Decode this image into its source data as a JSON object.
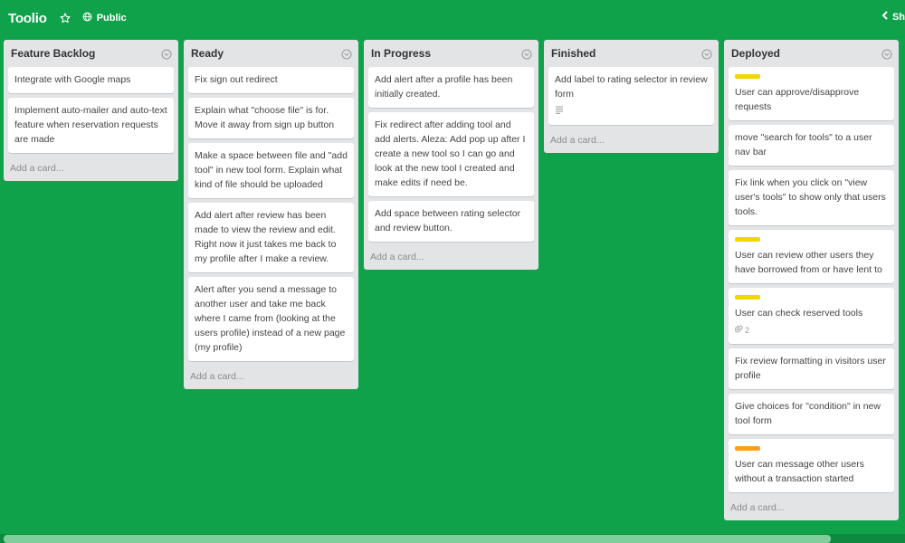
{
  "board": {
    "title": "Toolio",
    "visibility": "Public",
    "show_menu": "Sh",
    "colors": {
      "background": "#10a24a",
      "list": "#e2e4e6"
    }
  },
  "lists": [
    {
      "title": "Feature Backlog",
      "cards": [
        {
          "text": "Integrate with Google maps"
        },
        {
          "text": "Implement auto-mailer and auto-text feature when reservation requests are made"
        }
      ],
      "add_card": "Add a card..."
    },
    {
      "title": "Ready",
      "cards": [
        {
          "text": "Fix sign out redirect"
        },
        {
          "text": "Explain what \"choose file\" is for. Move it away from sign up button"
        },
        {
          "text": "Make a space between file and \"add tool\" in new tool form. Explain what kind of file should be uploaded"
        },
        {
          "text": "Add alert after review has been made to view the review and edit. Right now it just takes me back to my profile after I make a review."
        },
        {
          "text": "Alert after you send a message to another user and take me back where I came from (looking at the users profile) instead of a new page (my profile)"
        }
      ],
      "add_card": "Add a card..."
    },
    {
      "title": "In Progress",
      "cards": [
        {
          "text": "Add alert after a profile has been initially created."
        },
        {
          "text": "Fix redirect after adding tool and add alerts. Aleza: Add pop up after I create a new tool so I can go and look at the new tool I created and make edits if need be."
        },
        {
          "text": "Add space between rating selector and review button."
        }
      ],
      "add_card": "Add a card..."
    },
    {
      "title": "Finished",
      "cards": [
        {
          "text": "Add label to rating selector in review form",
          "badge_icon": "description-icon"
        }
      ],
      "add_card": "Add a card..."
    },
    {
      "title": "Deployed",
      "cards": [
        {
          "text": "User can approve/disapprove requests",
          "label_color": "#f2d600"
        },
        {
          "text": "move \"search for tools\" to a user nav bar"
        },
        {
          "text": "Fix link when you click on \"view user's tools\" to show only that users tools."
        },
        {
          "text": "User can review other users they have borrowed from or have lent to",
          "label_color": "#f2d600"
        },
        {
          "text": "User can check reserved tools",
          "label_color": "#f2d600",
          "badge_icon": "attachment-icon",
          "badge_count": "2"
        },
        {
          "text": "Fix review formatting in visitors user profile"
        },
        {
          "text": "Give choices for \"condition\" in new tool form"
        },
        {
          "text": "User can message other users without a transaction started",
          "label_color": "#ff9f1a"
        }
      ],
      "add_card": "Add a card..."
    }
  ]
}
